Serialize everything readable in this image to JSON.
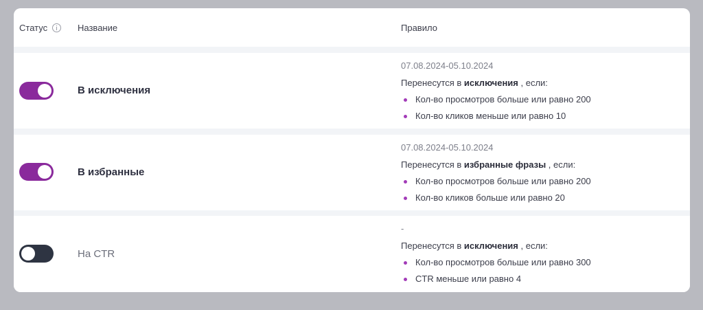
{
  "header": {
    "status_label": "Статус",
    "name_label": "Название",
    "rule_label": "Правило"
  },
  "colors": {
    "toggle_on": "#8a2a9c",
    "toggle_off": "#2e3442",
    "bullet": "#a23bb8"
  },
  "rows": [
    {
      "enabled": true,
      "name": "В исключения",
      "date": "07.08.2024-05.10.2024",
      "intro_prefix": "Перенесутся в ",
      "intro_target": "исключения",
      "intro_suffix": " , если:",
      "conditions": [
        "Кол-во просмотров больше или равно 200",
        "Кол-во кликов меньше или равно 10"
      ]
    },
    {
      "enabled": true,
      "name": "В избранные",
      "date": "07.08.2024-05.10.2024",
      "intro_prefix": "Перенесутся в ",
      "intro_target": "избранные фразы",
      "intro_suffix": " , если:",
      "conditions": [
        "Кол-во просмотров больше или равно 200",
        "Кол-во кликов больше или равно 20"
      ]
    },
    {
      "enabled": false,
      "name": "На CTR",
      "date": "-",
      "intro_prefix": "Перенесутся в ",
      "intro_target": "исключения",
      "intro_suffix": " , если:",
      "conditions": [
        "Кол-во просмотров больше или равно 300",
        "CTR меньше или равно 4"
      ]
    }
  ]
}
